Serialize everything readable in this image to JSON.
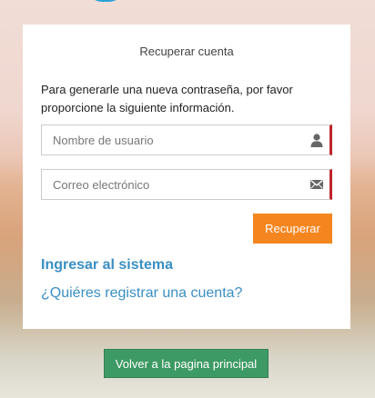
{
  "recover_form": {
    "title": "Recuperar cuenta",
    "instructions": "Para generarle una nueva contraseña, por favor proporcione la siguiente información.",
    "username": {
      "placeholder": "Nombre de usuario",
      "value": "",
      "icon": "user-icon"
    },
    "email": {
      "placeholder": "Correo electrónico",
      "value": "",
      "icon": "envelope-icon"
    },
    "submit_label": "Recuperar",
    "login_link": "Ingresar al sistema",
    "register_link": "¿Quiéres registrar una cuenta?"
  },
  "footer": {
    "home_button_label": "Volver a la pagina principal"
  },
  "colors": {
    "accent_orange": "#f5861f",
    "link_blue": "#3a8fc4",
    "home_button_green": "#3e9a64",
    "required_red": "#c0242b"
  }
}
